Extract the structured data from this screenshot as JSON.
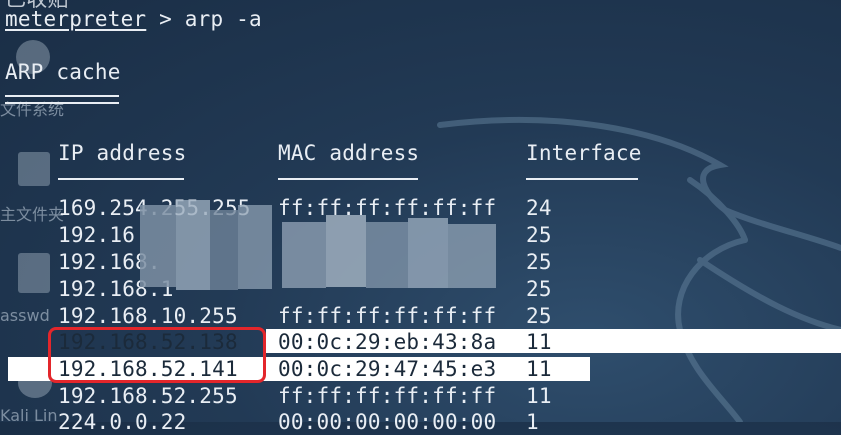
{
  "terminal": {
    "partial_top": "已收贴",
    "prompt_user": "meterpreter",
    "prompt_rest": " > arp -a",
    "section_title": "ARP cache",
    "headers": {
      "ip": "IP address",
      "mac": "MAC address",
      "iface": "Interface"
    },
    "rows": [
      {
        "ip": "169.254.255.255",
        "mac": "ff:ff:ff:ff:ff:ff",
        "iface": "24"
      },
      {
        "ip": "192.16",
        "mac": "",
        "iface": "25"
      },
      {
        "ip": "192.168.",
        "mac": "",
        "iface": "25"
      },
      {
        "ip": "192.168.1",
        "mac": "",
        "iface": "25"
      },
      {
        "ip": "192.168.10.255",
        "mac": "ff:ff:ff:ff:ff:ff",
        "iface": "25"
      },
      {
        "ip": "192.168.52.138",
        "mac": "00:0c:29:eb:43:8a",
        "iface": "11"
      },
      {
        "ip": "192.168.52.141",
        "mac": "00:0c:29:47:45:e3",
        "iface": "11"
      },
      {
        "ip": "192.168.52.255",
        "mac": "ff:ff:ff:ff:ff:ff",
        "iface": "11"
      },
      {
        "ip": "224.0.0.22",
        "mac": "00:00:00:00:00:00",
        "iface": "1"
      }
    ]
  },
  "desktop": {
    "filesystem_label": "文件系统",
    "home_label": "主文件夹",
    "passwd_label": "asswd",
    "kali_label": "Kali Lin"
  },
  "colors": {
    "background": "#223a55",
    "text": "#e9eef4",
    "highlight_box": "#e3262b",
    "highlight_strip": "#ffffff"
  }
}
